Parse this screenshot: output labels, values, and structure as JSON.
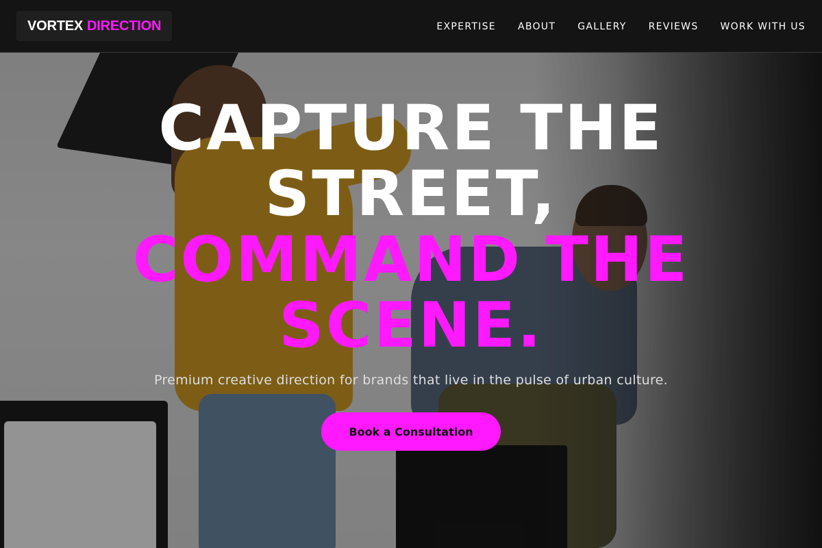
{
  "brand": {
    "name_primary": "VORTEX",
    "name_accent": "DIRECTION"
  },
  "nav": {
    "items": [
      {
        "label": "EXPERTISE"
      },
      {
        "label": "ABOUT"
      },
      {
        "label": "GALLERY"
      },
      {
        "label": "REVIEWS"
      },
      {
        "label": "WORK WITH US"
      }
    ]
  },
  "hero": {
    "headline_line1": "CAPTURE THE",
    "headline_line2": "STREET,",
    "headline_line3": "COMMAND THE",
    "headline_line4": "SCENE.",
    "subheadline": "Premium creative direction for brands that live in the pulse of urban culture.",
    "cta_label": "Book a Consultation"
  },
  "colors": {
    "accent": "#ff19ff",
    "nav_background": "#141414",
    "text_primary": "#ffffff"
  }
}
